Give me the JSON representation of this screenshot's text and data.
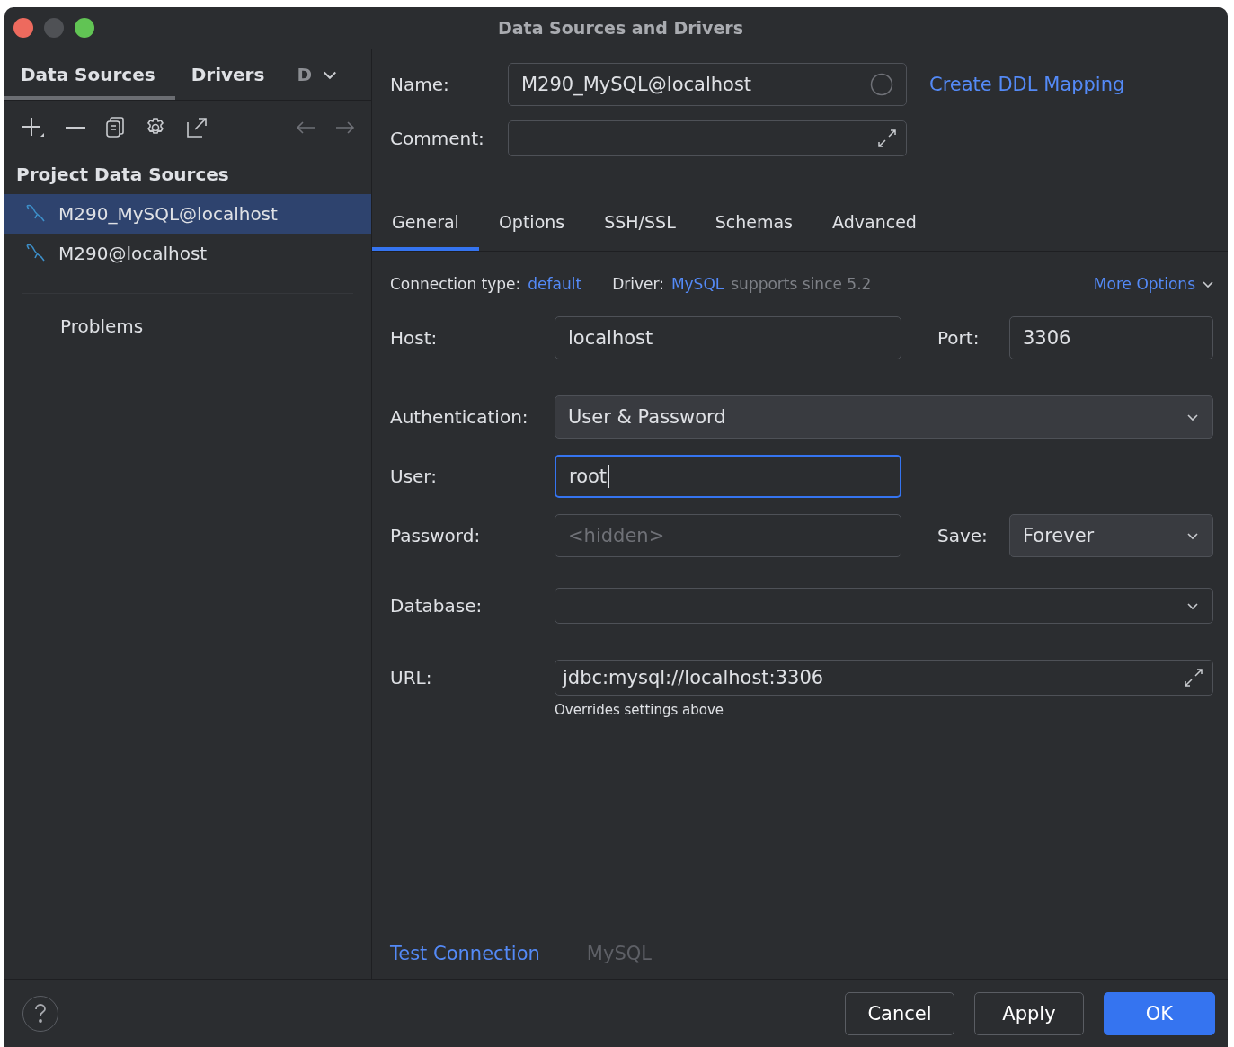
{
  "window": {
    "title": "Data Sources and Drivers"
  },
  "sidebar": {
    "tabs": [
      {
        "label": "Data Sources",
        "selected": true
      },
      {
        "label": "Drivers",
        "selected": false
      },
      {
        "label": "D",
        "selected": false
      }
    ],
    "section_title": "Project Data Sources",
    "items": [
      {
        "label": "M290_MySQL@localhost",
        "selected": true
      },
      {
        "label": "M290@localhost",
        "selected": false
      }
    ],
    "problems": "Problems"
  },
  "header": {
    "name_label": "Name:",
    "name_value": "M290_MySQL@localhost",
    "comment_label": "Comment:",
    "link": "Create DDL Mapping"
  },
  "tabs": [
    {
      "label": "General",
      "selected": true
    },
    {
      "label": "Options",
      "selected": false
    },
    {
      "label": "SSH/SSL",
      "selected": false
    },
    {
      "label": "Schemas",
      "selected": false
    },
    {
      "label": "Advanced",
      "selected": false
    }
  ],
  "connection": {
    "type_label": "Connection type:",
    "type": "default",
    "driver_label": "Driver:",
    "driver": "MySQL",
    "driver_note": "supports since 5.2",
    "more_options": "More Options"
  },
  "form": {
    "host": {
      "label": "Host:",
      "value": "localhost"
    },
    "port": {
      "label": "Port:",
      "value": "3306"
    },
    "authentication": {
      "label": "Authentication:",
      "value": "User & Password"
    },
    "user": {
      "label": "User:",
      "value": "root",
      "focused": true
    },
    "password": {
      "label": "Password:",
      "placeholder": "<hidden>"
    },
    "save": {
      "label": "Save:",
      "value": "Forever"
    },
    "database": {
      "label": "Database:"
    },
    "url": {
      "label": "URL:",
      "value": "jdbc:mysql://localhost:3306",
      "hint": "Overrides settings above"
    }
  },
  "footer": {
    "test_connection": "Test Connection",
    "driver_name": "MySQL"
  },
  "buttons": [
    {
      "label": "Cancel",
      "kind": "secondary"
    },
    {
      "label": "Apply",
      "kind": "secondary"
    },
    {
      "label": "OK",
      "kind": "primary"
    }
  ]
}
